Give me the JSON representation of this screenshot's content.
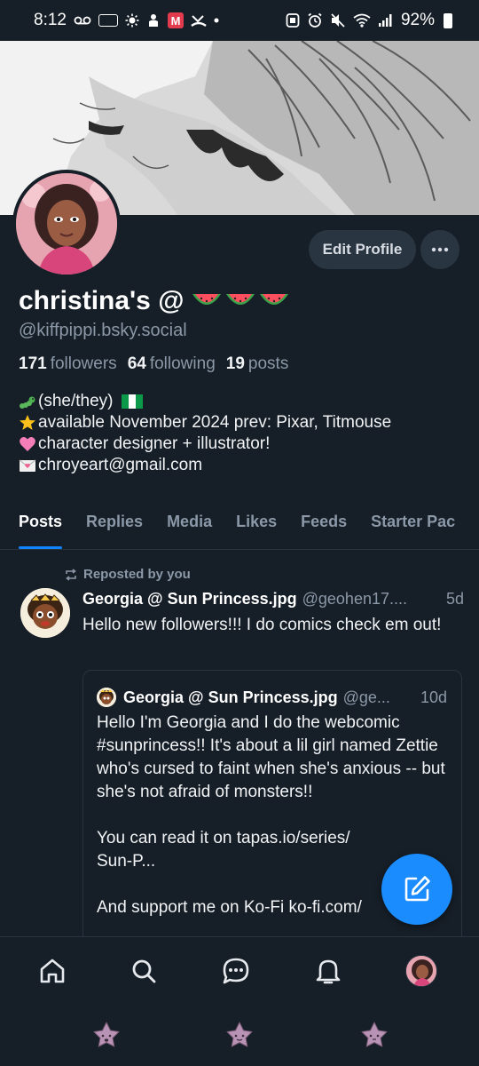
{
  "status_bar": {
    "time": "8:12",
    "battery": "92%",
    "icons_left": [
      "voicemail-icon",
      "sim-icon",
      "brightness-icon",
      "android-icon",
      "mail-m-icon",
      "missed-call-icon",
      "dot-icon"
    ],
    "icons_right": [
      "nfc-icon",
      "alarm-icon",
      "mute-icon",
      "wifi-icon",
      "signal-icon",
      "battery-icon"
    ]
  },
  "profile": {
    "display_name": "christina's @",
    "display_name_emoji": [
      "watermelon",
      "watermelon",
      "watermelon"
    ],
    "handle": "@kiffpippi.bsky.social",
    "edit_button": "Edit Profile",
    "more_button": "···",
    "stats": {
      "followers_count": "171",
      "followers_label": "followers",
      "following_count": "64",
      "following_label": "following",
      "posts_count": "19",
      "posts_label": "posts"
    },
    "bio": [
      {
        "emoji": "caterpillar",
        "text": "(she/they) "
      },
      {
        "emoji": "star",
        "text": "available November 2024 prev: Pixar, Titmouse"
      },
      {
        "emoji": "pink-heart",
        "text": "character designer + illustrator!"
      },
      {
        "emoji": "envelope",
        "text": "chroyeart@gmail.com"
      }
    ]
  },
  "tabs": [
    "Posts",
    "Replies",
    "Media",
    "Likes",
    "Feeds",
    "Starter Pac"
  ],
  "active_tab": "Posts",
  "feed": {
    "repost_label": "Reposted by you",
    "post": {
      "author": "Georgia @ Sun Princess.jpg",
      "handle": "@geohen17....",
      "time": "5d",
      "text": "Hello new followers!!! I do comics check em out!",
      "quote": {
        "author": "Georgia @ Sun Princess.jpg",
        "handle": "@ge...",
        "time": "10d",
        "text": "Hello I'm Georgia and I do the webcomic #sunprincess!! It's about a lil girl named Zettie who's cursed to faint when she's anxious -- but she's not afraid of monsters!!\n\nYou can read it on tapas.io/series/\nSun-P...\n\nAnd support me on Ko-Fi ko-fi.com/"
      }
    }
  },
  "nav": [
    "home-icon",
    "search-icon",
    "chat-icon",
    "bell-icon",
    "profile-avatar"
  ],
  "colors": {
    "background": "#161e27",
    "accent": "#1083fe",
    "muted_text": "#8b98a7",
    "button_bg": "#2a3542"
  }
}
